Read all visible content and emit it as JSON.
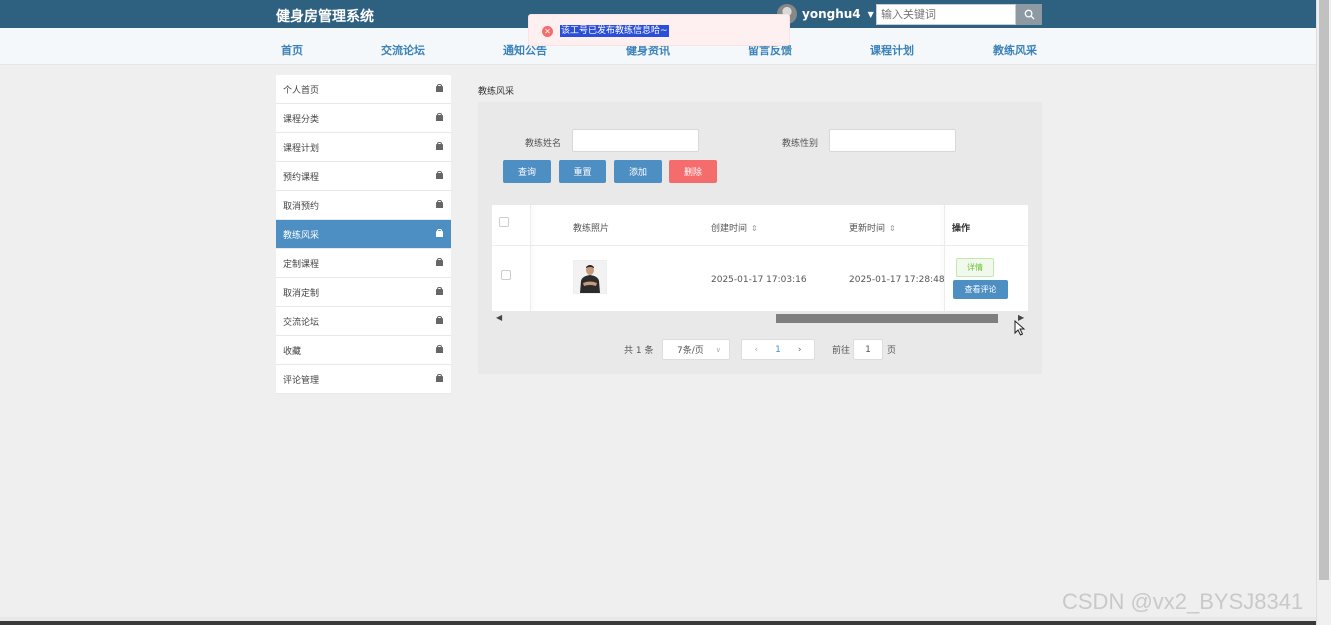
{
  "header": {
    "title": "健身房管理系统",
    "username": "yonghu4",
    "search_placeholder": "输入关键词"
  },
  "nav": {
    "items": [
      "首页",
      "交流论坛",
      "通知公告",
      "健身资讯",
      "留言反馈",
      "课程计划",
      "教练风采"
    ]
  },
  "toast": {
    "message": "该工号已发布教练信息哈~",
    "type": "error"
  },
  "sidebar": {
    "items": [
      {
        "label": "个人首页",
        "active": false
      },
      {
        "label": "课程分类",
        "active": false
      },
      {
        "label": "课程计划",
        "active": false
      },
      {
        "label": "预约课程",
        "active": false
      },
      {
        "label": "取消预约",
        "active": false
      },
      {
        "label": "教练风采",
        "active": true
      },
      {
        "label": "定制课程",
        "active": false
      },
      {
        "label": "取消定制",
        "active": false
      },
      {
        "label": "交流论坛",
        "active": false
      },
      {
        "label": "收藏",
        "active": false
      },
      {
        "label": "评论管理",
        "active": false
      }
    ]
  },
  "breadcrumb": "教练风采",
  "filters": {
    "name_label": "教练姓名",
    "gender_label": "教练性别"
  },
  "buttons": {
    "query": "查询",
    "reset": "重置",
    "add": "添加",
    "delete": "删除"
  },
  "table": {
    "headers": {
      "photo": "教练照片",
      "created": "创建时间",
      "updated": "更新时间",
      "actions": "操作"
    },
    "rows": [
      {
        "created": "2025-01-17 17:03:16",
        "updated": "2025-01-17 17:28:48",
        "detail_label": "详情",
        "comment_label": "查看评论"
      }
    ]
  },
  "pagination": {
    "total": "共 1 条",
    "page_size": "7条/页",
    "current_page": "1",
    "goto_label": "前往",
    "goto_value": "1",
    "page_unit": "页"
  },
  "watermark": "CSDN @vx2_BYSJ8341",
  "colors": {
    "topbar": "#2e6080",
    "primary": "#4d8ec3",
    "danger": "#f56c6c",
    "nav_text": "#3b82b8"
  }
}
